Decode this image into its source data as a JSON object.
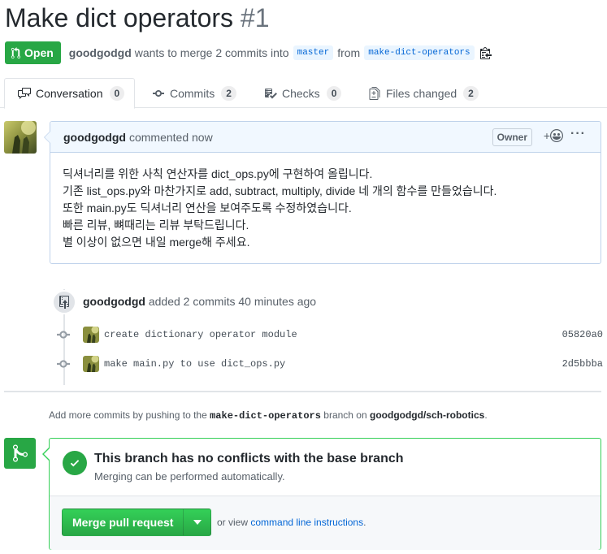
{
  "pr": {
    "title": "Make dict operators",
    "number": "#1",
    "state": "Open",
    "author": "goodgodgd",
    "merge_text": "wants to merge 2 commits into",
    "base_branch": "master",
    "from_text": "from",
    "head_branch": "make-dict-operators"
  },
  "tabs": [
    {
      "label": "Conversation",
      "count": "0",
      "icon": "comment-discussion-icon"
    },
    {
      "label": "Commits",
      "count": "2",
      "icon": "git-commit-icon"
    },
    {
      "label": "Checks",
      "count": "0",
      "icon": "checklist-icon"
    },
    {
      "label": "Files changed",
      "count": "2",
      "icon": "diff-icon"
    }
  ],
  "comment": {
    "author": "goodgodgd",
    "action": "commented now",
    "role_label": "Owner",
    "react_plus": "+",
    "more": "···",
    "body_lines": [
      "딕셔너리를 위한 사칙 연산자를 dict_ops.py에 구현하여 올립니다.",
      "기존 list_ops.py와 마찬가지로 add, subtract, multiply, divide 네 개의 함수를 만들었습니다.",
      "또한 main.py도 딕셔너리 연산을 보여주도록 수정하였습니다.",
      "빠른 리뷰, 뼈때리는 리뷰 부탁드립니다.",
      "별 이상이 없으면 내일 merge해 주세요."
    ]
  },
  "commits_event": {
    "author": "goodgodgd",
    "text": "added 2 commits 40 minutes ago",
    "commits": [
      {
        "message": "create dictionary operator module",
        "sha": "05820a0"
      },
      {
        "message": "make main.py to use dict_ops.py",
        "sha": "2d5bbba"
      }
    ]
  },
  "push_hint": {
    "prefix": "Add more commits by pushing to the",
    "branch": "make-dict-operators",
    "middle": "branch on",
    "repo": "goodgodgd/sch-robotics",
    "suffix": "."
  },
  "merge": {
    "heading": "This branch has no conflicts with the base branch",
    "subtext": "Merging can be performed automatically.",
    "button_label": "Merge pull request",
    "or_view": "or view",
    "cli_link": "command line instructions",
    "suffix": "."
  },
  "colors": {
    "green": "#28a745",
    "link_blue": "#0366d6",
    "header_blue": "#f1f8ff"
  }
}
